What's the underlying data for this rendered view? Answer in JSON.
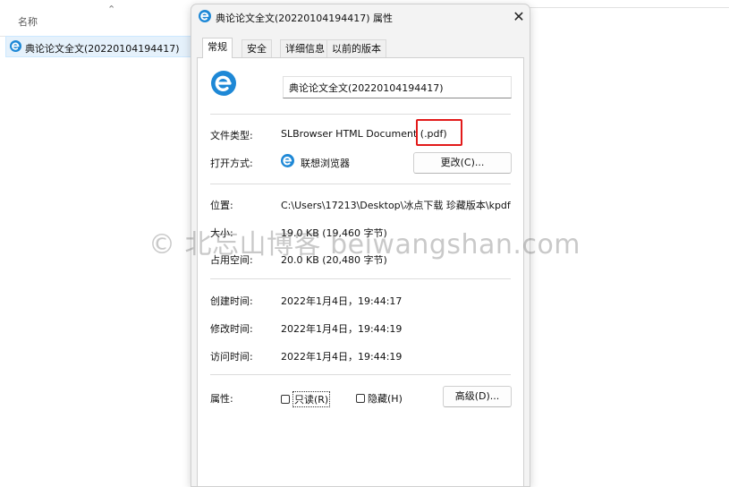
{
  "explorer": {
    "column_header": "名称",
    "sort_glyph": "⌃",
    "selected_file": "典论论文全文(20220104194417)"
  },
  "dialog": {
    "title": "典论论文全文(20220104194417) 属性",
    "close_glyph": "✕",
    "tabs": [
      "常规",
      "安全",
      "详细信息",
      "以前的版本"
    ],
    "active_tab": "常规",
    "file_name": "典论论文全文(20220104194417)",
    "file_type_label": "文件类型:",
    "file_type_value": "SLBrowser HTML Document (.pdf)",
    "open_with_label": "打开方式:",
    "open_with_value": "联想浏览器",
    "change_button": "更改(C)...",
    "location_label": "位置:",
    "location_value": "C:\\Users\\17213\\Desktop\\冰点下载 珍藏版本\\kpdf",
    "size_label": "大小:",
    "size_value": "19.0 KB (19,460 字节)",
    "size_on_disk_label": "占用空间:",
    "size_on_disk_value": "20.0 KB (20,480 字节)",
    "created_label": "创建时间:",
    "created_value": "2022年1月4日，19:44:17",
    "modified_label": "修改时间:",
    "modified_value": "2022年1月4日，19:44:19",
    "accessed_label": "访问时间:",
    "accessed_value": "2022年1月4日，19:44:19",
    "attributes_label": "属性:",
    "readonly_label": "只读(R)",
    "hidden_label": "隐藏(H)",
    "advanced_button": "高级(D)..."
  },
  "watermark": "© 北忘山博客 beiwangshan.com",
  "colors": {
    "highlight": "#e21a1a",
    "app_icon": "#1e88d6"
  }
}
